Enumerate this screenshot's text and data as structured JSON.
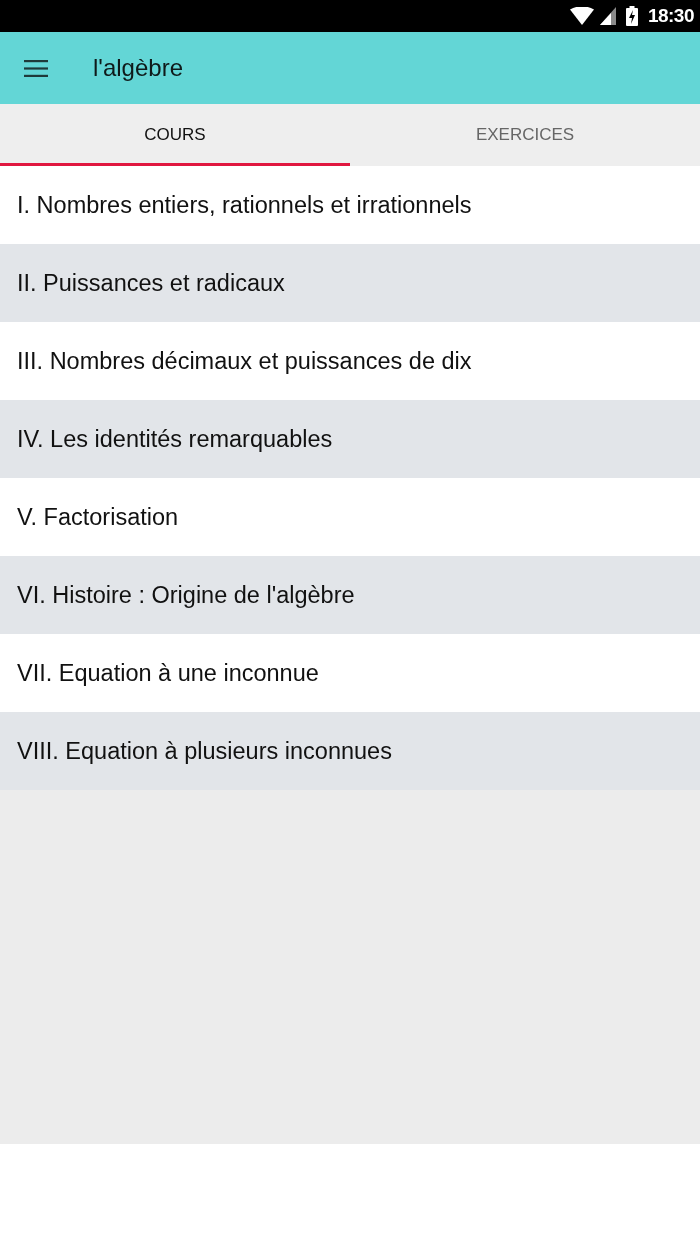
{
  "status_bar": {
    "time": "18:30"
  },
  "app_bar": {
    "title": "l'algèbre"
  },
  "tabs": [
    {
      "label": "COURS",
      "selected": true
    },
    {
      "label": "EXERCICES",
      "selected": false
    }
  ],
  "chapters": [
    "I. Nombres entiers, rationnels et irrationnels",
    "II. Puissances et radicaux",
    "III. Nombres décimaux et puissances de dix",
    "IV. Les identités remarquables",
    "V. Factorisation",
    "VI. Histoire : Origine de l'algèbre",
    "VII. Equation à une inconnue",
    "VIII. Equation à plusieurs inconnues"
  ]
}
